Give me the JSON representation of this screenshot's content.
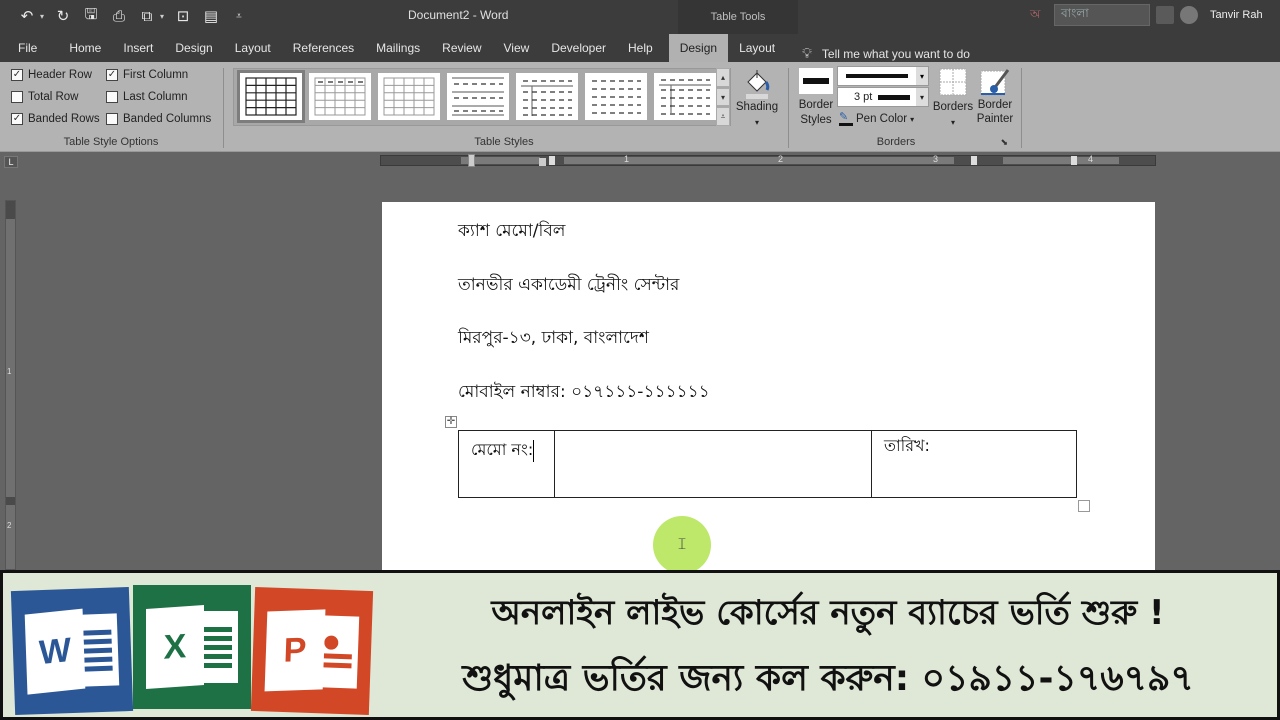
{
  "window": {
    "title": "Document2  -  Word",
    "context_tab_group": "Table Tools",
    "language_indicator": "বাংলা",
    "user_name": "Tanvir Rah"
  },
  "quick_access": [
    {
      "icon": "undo-icon",
      "glyph": "↶"
    },
    {
      "icon": "redo-icon",
      "glyph": "↻"
    },
    {
      "icon": "save-icon",
      "glyph": "🖫"
    },
    {
      "icon": "print-icon",
      "glyph": "⎙"
    },
    {
      "icon": "paste-options-icon",
      "glyph": "⧉"
    },
    {
      "icon": "screenshot-icon",
      "glyph": "⊡"
    },
    {
      "icon": "form-icon",
      "glyph": "▤"
    },
    {
      "icon": "customize-qat-icon",
      "glyph": "⩡"
    }
  ],
  "tabs": [
    {
      "label": "File"
    },
    {
      "label": "Home"
    },
    {
      "label": "Insert"
    },
    {
      "label": "Design"
    },
    {
      "label": "Layout"
    },
    {
      "label": "References"
    },
    {
      "label": "Mailings"
    },
    {
      "label": "Review"
    },
    {
      "label": "View"
    },
    {
      "label": "Developer"
    },
    {
      "label": "Help"
    },
    {
      "label": "Design",
      "active": true,
      "context": "Table Tools"
    },
    {
      "label": "Layout",
      "context": "Table Tools"
    }
  ],
  "tell_me": "Tell me what you want to do",
  "ribbon": {
    "table_style_options": {
      "label": "Table Style Options",
      "options": [
        {
          "label": "Header Row",
          "checked": true
        },
        {
          "label": "Total Row",
          "checked": false
        },
        {
          "label": "Banded Rows",
          "checked": true
        },
        {
          "label": "First Column",
          "checked": true
        },
        {
          "label": "Last Column",
          "checked": false
        },
        {
          "label": "Banded Columns",
          "checked": false
        }
      ]
    },
    "table_styles": {
      "label": "Table Styles",
      "selected_index": 0,
      "count": 7
    },
    "shading": {
      "label": "Shading"
    },
    "borders": {
      "label": "Borders",
      "border_styles": "Border Styles",
      "line_weight": "3 pt",
      "pen_color": "Pen Color",
      "borders_button": "Borders",
      "border_painter": "Border Painter"
    }
  },
  "rulers": {
    "horizontal_numbers": [
      "1",
      "2",
      "3",
      "4"
    ],
    "vertical_numbers": [
      "1",
      "2"
    ],
    "tab_selector": "L"
  },
  "document": {
    "lines": [
      "ক্যাশ মেমো/বিল",
      "তানভীর একাডেমী ট্রেনীং সেন্টার",
      "মিরপুর-১৩, ঢাকা, বাংলাদেশ",
      "মোবাইল নাম্বার: ০১৭১১১-১১১১১১"
    ],
    "table": {
      "cells": [
        "মেমো নং:",
        "",
        "তারিখ:"
      ]
    }
  },
  "banner": {
    "line1": "অনলাইন লাইভ কোর্সের নতুন ব্যাচের ভর্তি শুরু !",
    "line2": "শুধুমাত্র ভর্তির জন্য কল করুন: ০১৯১১-১৭৬৭৯৭",
    "logos": [
      {
        "letter": "W",
        "app": "Word",
        "color": "#2b5797"
      },
      {
        "letter": "X",
        "app": "Excel",
        "color": "#1e7145"
      },
      {
        "letter": "P",
        "app": "PowerPoint",
        "color": "#d24726"
      }
    ]
  },
  "colors": {
    "title_bar": "#3c3c3c",
    "ribbon": "#b3b3b3",
    "workspace": "#646464",
    "cursor_highlight": "#bde86a",
    "banner_bg": "#dfe8d6"
  }
}
